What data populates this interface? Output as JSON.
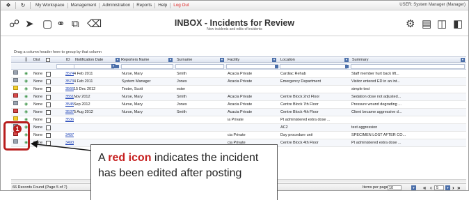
{
  "menubar": {
    "items": [
      "My Workspace",
      "Management",
      "Administration",
      "Reports",
      "Help"
    ],
    "logout": "Log Out",
    "user": "USER: System Manager (Manager)"
  },
  "header": {
    "title": "INBOX - Incidents for Review",
    "subtitle": "New incidents and edits of incidents"
  },
  "grid": {
    "group_hint": "Drag a column header here to group by that column",
    "columns": [
      "Dist",
      "ID",
      "Notification Date",
      "Reporters Name",
      "Surname",
      "Facility",
      "Location",
      "Summary"
    ],
    "rows": [
      {
        "dist": "None",
        "id": "3574",
        "date": "4 Feb 2011",
        "reporter": "Nurse, Mary",
        "surname": "Smith",
        "facility": "Acacia Private",
        "location": "Cardiac Rehab",
        "summary": "Staff member hurt back lift..."
      },
      {
        "dist": "None",
        "id": "3573",
        "date": "4 Feb 2011",
        "reporter": "System Manager",
        "surname": "Jones",
        "facility": "Acacia Private",
        "location": "Emergency Department",
        "summary": "Visitor entered ED in an int..."
      },
      {
        "dist": "None",
        "id": "3566",
        "date": "15 Dec 2012",
        "reporter": "Tester, Scott",
        "surname": "ester",
        "facility": "",
        "location": "",
        "summary": "simple test"
      },
      {
        "dist": "None",
        "id": "3551",
        "date": "Nov 2012",
        "reporter": "Nurse, Mary",
        "surname": "Smith",
        "facility": "Acacia Private",
        "location": "Centre Block 2nd Floor",
        "summary": "Sedation dose not adjusted..."
      },
      {
        "dist": "None",
        "id": "3545",
        "date": "Sep 2012",
        "reporter": "Nurse, Mary",
        "surname": "Jones",
        "facility": "Acacia Private",
        "location": "Centre Block 7th Floor",
        "summary": "Pressure wound degrading ..."
      },
      {
        "dist": "None",
        "id": "3537",
        "date": "5 Aug 2012",
        "reporter": "Nurse, Mary",
        "surname": "Smith",
        "facility": "Acacia Private",
        "location": "Centre Block 4th Floor",
        "summary": "Client became aggressive d..."
      },
      {
        "dist": "None",
        "id": "3536",
        "date": "",
        "reporter": "",
        "surname": "",
        "facility": "ia Private",
        "location": "Pt administered extra dose ...",
        "summary": ""
      },
      {
        "dist": "None",
        "id": "",
        "date": "",
        "reporter": "",
        "surname": "",
        "facility": "",
        "location": "AC2",
        "summary": "test aggression"
      },
      {
        "dist": "None",
        "id": "3497",
        "date": "",
        "reporter": "",
        "surname": "",
        "facility": "cia Private",
        "location": "Day procedure unit",
        "summary": "SPECIMEN LOST AFTER CO..."
      },
      {
        "dist": "None",
        "id": "3493",
        "date": "",
        "reporter": "",
        "surname": "",
        "facility": "cia Private",
        "location": "Centre Block 4th Floor",
        "summary": "Pt administered extra dose ..."
      }
    ],
    "records_found": "66 Records Found (Page 5 of 7)",
    "items_per_page_label": "Items per page:",
    "items_per_page": "10",
    "page": "5"
  },
  "callout": {
    "marker": "1",
    "prefix": "A ",
    "highlight": "red icon",
    "suffix": " indicates the incident has been edited after posting"
  },
  "colors": {
    "accent": "#b81e1e",
    "link": "#1a3fb5",
    "header_blue": "#4a6ea9"
  }
}
